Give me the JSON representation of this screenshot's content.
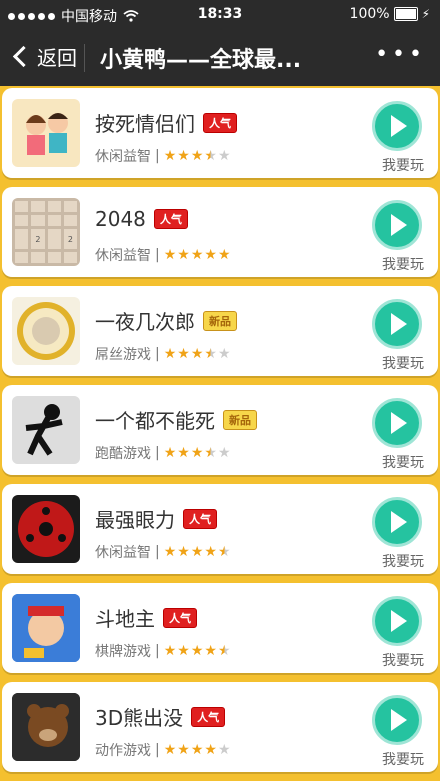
{
  "status": {
    "carrier": "中国移动",
    "time": "18:33",
    "battery": "100%"
  },
  "nav": {
    "back_label": "返回",
    "title": "小黄鸭——全球最...",
    "more_label": "•••"
  },
  "play_label": "我要玩",
  "games": [
    {
      "name": "按死情侣们",
      "badge": "人气",
      "badge_type": "hot",
      "category": "休闲益智",
      "rating": 3.5,
      "thumb": "couple"
    },
    {
      "name": "2048",
      "badge": "人气",
      "badge_type": "hot",
      "category": "休闲益智",
      "rating": 5,
      "thumb": "2048"
    },
    {
      "name": "一夜几次郎",
      "badge": "新品",
      "badge_type": "new",
      "category": "屌丝游戏",
      "rating": 3.5,
      "thumb": "ring"
    },
    {
      "name": "一个都不能死",
      "badge": "新品",
      "badge_type": "new",
      "category": "跑酷游戏",
      "rating": 3.5,
      "thumb": "stick"
    },
    {
      "name": "最强眼力",
      "badge": "人气",
      "badge_type": "hot",
      "category": "休闲益智",
      "rating": 4.5,
      "thumb": "eye"
    },
    {
      "name": "斗地主",
      "badge": "人气",
      "badge_type": "hot",
      "category": "棋牌游戏",
      "rating": 4.5,
      "thumb": "doudizhu"
    },
    {
      "name": "3D熊出没",
      "badge": "人气",
      "badge_type": "hot",
      "category": "动作游戏",
      "rating": 4,
      "thumb": "bear"
    }
  ],
  "colors": {
    "bg": "#f4c02f",
    "nav": "#2b2b2b",
    "play": "#25c3a0"
  }
}
